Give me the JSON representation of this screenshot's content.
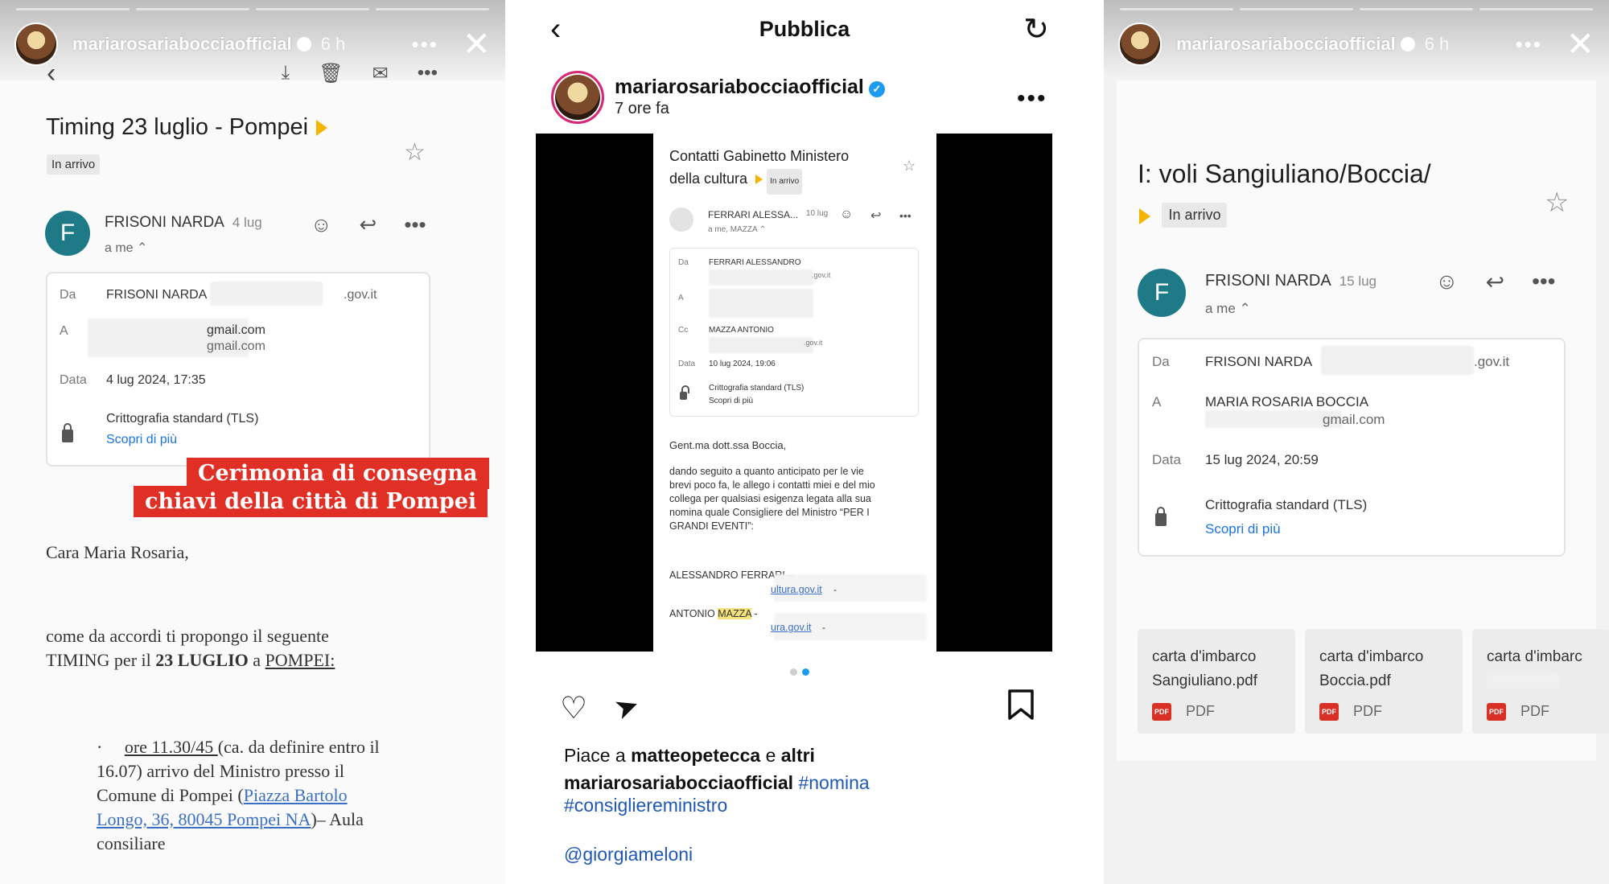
{
  "story1": {
    "username": "mariarosariabocciaofficial",
    "time": "6 h",
    "more": "•••",
    "close": "✕",
    "toolbar": {
      "back": "‹",
      "archive": "⤓",
      "delete": "🗑",
      "mark": "✉",
      "more": "•••"
    },
    "subject": "Timing 23 luglio - Pompei",
    "label": "In arrivo",
    "sender_initial": "F",
    "sender": "FRISONI NARDA",
    "date_short": "4 lug",
    "to": "a me ⌃",
    "details": {
      "da_key": "Da",
      "da": "FRISONI NARDA",
      "da_domain": ".gov.it",
      "a_key": "A",
      "a1": "gmail.com",
      "a2": "gmail.com",
      "data_key": "Data",
      "data": "4 lug 2024, 17:35",
      "tls": "Crittografia standard (TLS)",
      "more": "Scopri di più"
    },
    "banner": [
      "Cerimonia di consegna",
      "chiavi della città di Pompei"
    ],
    "greeting": "Cara Maria Rosaria,",
    "body1": "come da accordi ti propongo il seguente",
    "body2_a": "TIMING per il ",
    "body2_b": "23 LUGLIO",
    "body2_c": " a ",
    "body2_d": "POMPEI:",
    "bullet": "·",
    "item_a": "ore 11.30/45 ",
    "item_b": "(ca. da definire entro il",
    "item_c": "16.07) arrivo del Ministro presso il",
    "item_d": "Comune di Pompei (",
    "item_e": "Piazza Bartolo",
    "item_f": "Longo, 36, 80045 Pompei NA",
    "item_g": ")– Aula",
    "item_h": "consiliare"
  },
  "post": {
    "title": "Pubblica",
    "back": "‹",
    "refresh": "↻",
    "username": "mariarosariabocciaofficial",
    "verified": "✓",
    "time": "7 ore fa",
    "more": "•••",
    "email": {
      "subject1": "Contatti Gabinetto Ministero",
      "subject2": "della cultura",
      "label": "In arrivo",
      "sender": "FERRARI ALESSA...",
      "date": "10 lug",
      "to": "a me, MAZZA ⌃",
      "da_key": "Da",
      "da": "FERRARI ALESSANDRO",
      "da_domain": ".gov.it",
      "a_key": "A",
      "cc_key": "Cc",
      "cc": "MAZZA ANTONIO",
      "cc_domain": ".gov.it",
      "data_key": "Data",
      "data": "10 lug 2024, 19:06",
      "tls": "Crittografia standard (TLS)",
      "more": "Scopri di più",
      "greeting": "Gent.ma dott.ssa Boccia,",
      "body": [
        "dando seguito a quanto anticipato per le vie",
        "brevi poco fa, le allego i contatti miei e del mio",
        "collega per qualsiasi esigenza legata alla sua",
        "nomina quale Consigliere del Ministro “PER I",
        "GRANDI EVENTI”:"
      ],
      "c1_name": "ALESSANDRO FERRARI –",
      "c1_mail": "ultura.gov.it",
      "c1_dash": "-",
      "c2_name_a": "ANTONIO ",
      "c2_name_b": "MAZZA",
      "c2_name_c": " -",
      "c2_mail": "ura.gov.it",
      "c2_dash": "-"
    },
    "likes_a": "Piace a ",
    "likes_b": "matteopetecca",
    "likes_c": " e ",
    "likes_d": "altri",
    "caption_user": "mariarosariabocciaofficial",
    "hashtag1": "#nomina",
    "hashtag2": "#consigliereministro",
    "mention": "@giorgiameloni"
  },
  "story2": {
    "username": "mariarosariabocciaofficial",
    "time": "6 h",
    "more": "•••",
    "close": "✕",
    "subject": "I: voli Sangiuliano/Boccia/",
    "label": "In arrivo",
    "sender_initial": "F",
    "sender": "FRISONI NARDA",
    "date_short": "15 lug",
    "to": "a me ⌃",
    "details": {
      "da_key": "Da",
      "da": "FRISONI NARDA",
      "da_domain": ".gov.it",
      "a_key": "A",
      "a": "MARIA ROSARIA BOCCIA",
      "a_mail": "gmail.com",
      "data_key": "Data",
      "data": "15 lug 2024, 20:59",
      "tls": "Crittografia standard (TLS)",
      "more": "Scopri di più"
    },
    "attachments": [
      {
        "line1": "carta d'imbarco",
        "line2": "Sangiuliano.pdf",
        "type": "PDF"
      },
      {
        "line1": "carta d'imbarco",
        "line2": "Boccia.pdf",
        "type": "PDF"
      },
      {
        "line1": "carta d'imbarc",
        "line2": "",
        "type": "PDF"
      }
    ],
    "pdf_badge": "PDF"
  },
  "colors": {
    "gmail_avatar": "#1f7a87",
    "important": "#f4b400",
    "link": "#1a73e8",
    "banner": "#e02f25",
    "hashtag": "#1f57b8"
  }
}
